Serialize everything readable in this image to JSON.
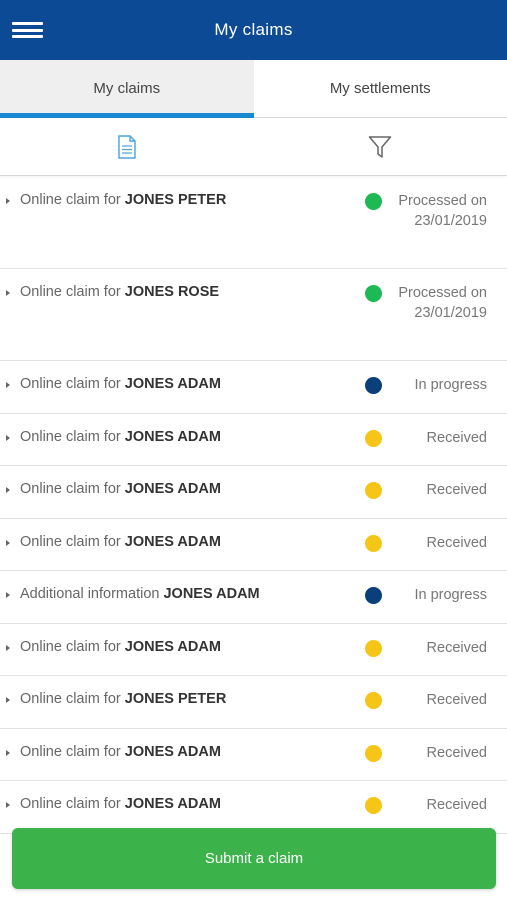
{
  "header": {
    "title": "My claims",
    "menu_icon": "hamburger-menu-icon"
  },
  "tabs": [
    {
      "label": "My claims",
      "active": true
    },
    {
      "label": "My settlements",
      "active": false
    }
  ],
  "toolbar": {
    "document_icon": "document-icon",
    "filter_icon": "filter-icon"
  },
  "colors": {
    "header": "#0d4a96",
    "tab_indicator": "#1a8ad0",
    "processed": "#1db954",
    "in_progress": "#0b3f7a",
    "received": "#f5c518",
    "submit": "#3bb34a"
  },
  "claims": [
    {
      "prefix": "Online claim for",
      "name": "JONES PETER",
      "status": "Processed on 23/01/2019",
      "state": "processed"
    },
    {
      "prefix": "Online claim for",
      "name": "JONES ROSE",
      "status": "Processed on 23/01/2019",
      "state": "processed"
    },
    {
      "prefix": "Online claim for",
      "name": "JONES ADAM",
      "status": "In progress",
      "state": "in_progress"
    },
    {
      "prefix": "Online claim for",
      "name": "JONES ADAM",
      "status": "Received",
      "state": "received"
    },
    {
      "prefix": "Online claim for",
      "name": "JONES ADAM",
      "status": "Received",
      "state": "received"
    },
    {
      "prefix": "Online claim for",
      "name": "JONES ADAM",
      "status": "Received",
      "state": "received"
    },
    {
      "prefix": "Additional information",
      "name": "JONES ADAM",
      "status": "In progress",
      "state": "in_progress"
    },
    {
      "prefix": "Online claim for",
      "name": "JONES ADAM",
      "status": "Received",
      "state": "received"
    },
    {
      "prefix": "Online claim for",
      "name": "JONES PETER",
      "status": "Received",
      "state": "received"
    },
    {
      "prefix": "Online claim for",
      "name": "JONES ADAM",
      "status": "Received",
      "state": "received"
    },
    {
      "prefix": "Online claim for",
      "name": "JONES ADAM",
      "status": "Received",
      "state": "received"
    }
  ],
  "submit_label": "Submit a claim"
}
